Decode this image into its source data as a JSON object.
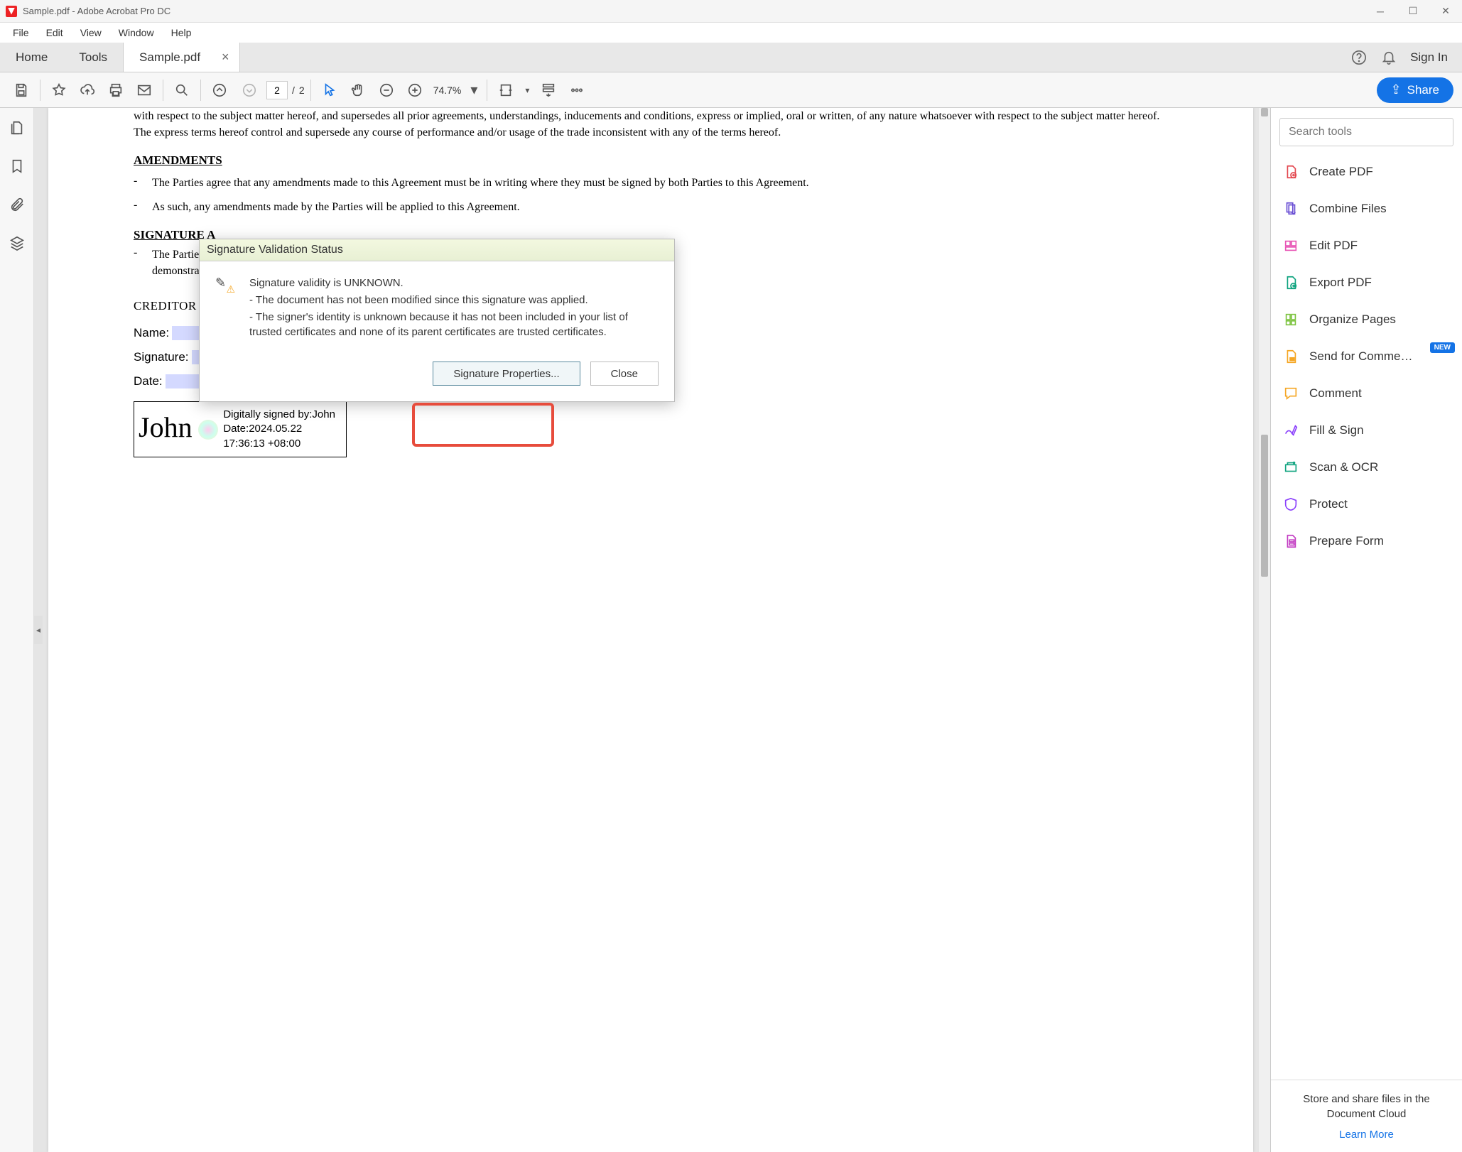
{
  "titlebar": {
    "title": "Sample.pdf - Adobe Acrobat Pro DC"
  },
  "menubar": [
    "File",
    "Edit",
    "View",
    "Window",
    "Help"
  ],
  "tabs": {
    "home": "Home",
    "tools": "Tools",
    "doc": "Sample.pdf"
  },
  "signin": "Sign In",
  "toolbar": {
    "page_current": "2",
    "page_sep": "/",
    "page_total": "2",
    "zoom": "74.7%",
    "share": "Share"
  },
  "doc": {
    "intro_fragment": "with respect to the subject matter hereof, and supersedes all prior agreements, understandings, inducements and conditions, express or implied, oral or written, of any nature whatsoever with respect to the subject matter hereof. The express terms hereof control and supersede any course of performance and/or usage of the trade inconsistent with any of the terms hereof.",
    "h_amend": "AMENDMENTS",
    "amend_1": "The Parties agree that any amendments made to this Agreement must be in writing where they must be signed by both Parties to this Agreement.",
    "amend_2": "As such, any amendments made by the Parties will be applied to this Agreement.",
    "h_sig": "SIGNATURE A",
    "sig_para": "The Parties h\ndemonstrated",
    "creditor": "CREDITOR",
    "f_name": "Name:",
    "f_sig": "Signature:",
    "f_date": "Date:",
    "sig_name": "John",
    "sig_meta1": "Digitally signed by:John",
    "sig_meta2": "Date:2024.05.22 17:36:13 +08:00"
  },
  "dialog": {
    "title": "Signature Validation Status",
    "l1": "Signature validity is UNKNOWN.",
    "l2": "- The document has not been modified since this signature was applied.",
    "l3": "- The signer's identity is unknown because it has not been included in your list of trusted certificates and none of its parent certificates are trusted certificates.",
    "btn_props": "Signature Properties...",
    "btn_close": "Close"
  },
  "rightpanel": {
    "search_placeholder": "Search tools",
    "tools": [
      {
        "label": "Create PDF",
        "color": "#e34850"
      },
      {
        "label": "Combine Files",
        "color": "#6a4fd4"
      },
      {
        "label": "Edit PDF",
        "color": "#e752b4"
      },
      {
        "label": "Export PDF",
        "color": "#0fa37f"
      },
      {
        "label": "Organize Pages",
        "color": "#7cc33f"
      },
      {
        "label": "Send for Comme…",
        "color": "#f5a623",
        "new": true
      },
      {
        "label": "Comment",
        "color": "#f5a623"
      },
      {
        "label": "Fill & Sign",
        "color": "#8a3ffc"
      },
      {
        "label": "Scan & OCR",
        "color": "#0fa37f"
      },
      {
        "label": "Protect",
        "color": "#8a3ffc"
      },
      {
        "label": "Prepare Form",
        "color": "#c33fc3"
      }
    ],
    "new_badge": "NEW",
    "footer_text": "Store and share files in the Document Cloud",
    "footer_link": "Learn More"
  }
}
